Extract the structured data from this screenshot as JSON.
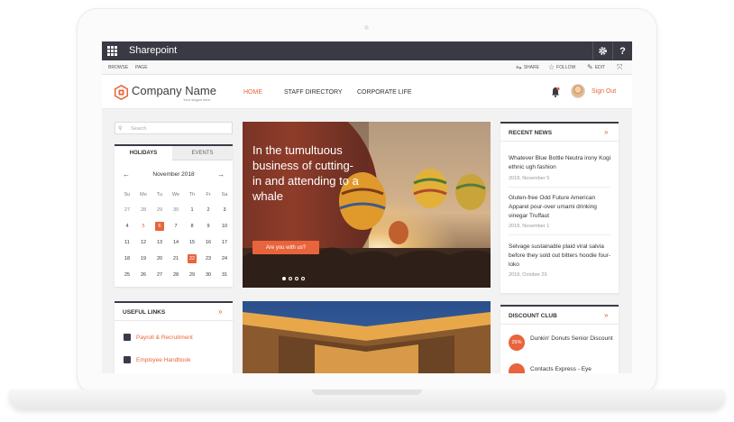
{
  "app": {
    "title": "Sharepoint"
  },
  "suite_buttons": {
    "settings": "gear-icon",
    "help": "?"
  },
  "ribbon": {
    "tabs": [
      "BROWSE",
      "PAGE"
    ],
    "actions": [
      {
        "label": "SHARE",
        "icon": "share-icon"
      },
      {
        "label": "FOLLOW",
        "icon": "star-icon"
      },
      {
        "label": "EDIT",
        "icon": "pencil-icon"
      },
      {
        "label": "",
        "icon": "focus-icon"
      }
    ]
  },
  "header": {
    "company": "Company Name",
    "tagline": "Your slogan here",
    "nav": [
      "HOME",
      "STAFF DIRECTORY",
      "CORPORATE LIFE"
    ],
    "active_nav": "HOME",
    "signout": "Sign Out"
  },
  "search": {
    "placeholder": "Search"
  },
  "calendar": {
    "tabs": [
      "HOLIDAYS",
      "EVENTS"
    ],
    "month": "November 2018",
    "weekdays": [
      "Su",
      "Mo",
      "Tu",
      "We",
      "Th",
      "Fr",
      "Sa"
    ],
    "weeks": [
      [
        "27",
        "28",
        "29",
        "30",
        "1",
        "2",
        "3"
      ],
      [
        "4",
        "5",
        "6",
        "7",
        "8",
        "9",
        "10"
      ],
      [
        "11",
        "12",
        "13",
        "14",
        "15",
        "16",
        "17"
      ],
      [
        "18",
        "19",
        "20",
        "21",
        "22",
        "23",
        "24"
      ],
      [
        "25",
        "26",
        "27",
        "28",
        "29",
        "30",
        "31"
      ]
    ],
    "holiday_day": "5",
    "highlighted_days": [
      "6",
      "22"
    ]
  },
  "useful_links": {
    "title": "USEFUL LINKS",
    "more": "»",
    "items": [
      {
        "label": "Payroll & Recruitment",
        "icon": "wallet-icon"
      },
      {
        "label": "Employee Handbook",
        "icon": "book-icon"
      }
    ]
  },
  "hero": {
    "headline": "In the tumultuous business of cutting-in and attending to a whale",
    "button": "Are you with us?",
    "slide_count": 4,
    "active_slide": 1
  },
  "recent_news": {
    "title": "RECENT NEWS",
    "more": "»",
    "items": [
      {
        "headline": "Whatever Blue Bottle Neutra irony Kogi ethnic ugh fashion",
        "date": "2018, November 5"
      },
      {
        "headline": "Gluten-free Odd Future American Apparel pour-over umami drinking vinegar Truffaut",
        "date": "2018, November 1"
      },
      {
        "headline": "Selvage sustainable plaid viral salvia before they sold out bitters hoodie four-loko",
        "date": "2018, October 29"
      }
    ]
  },
  "discount_club": {
    "title": "DISCOUNT CLUB",
    "more": "»",
    "items": [
      {
        "badge": "25%",
        "label": "Dunkin' Donuts Senior Discount"
      },
      {
        "badge": "",
        "label": "Contacts Express - Eye"
      }
    ]
  },
  "colors": {
    "accent": "#e8643c",
    "dark": "#3a3a44"
  }
}
